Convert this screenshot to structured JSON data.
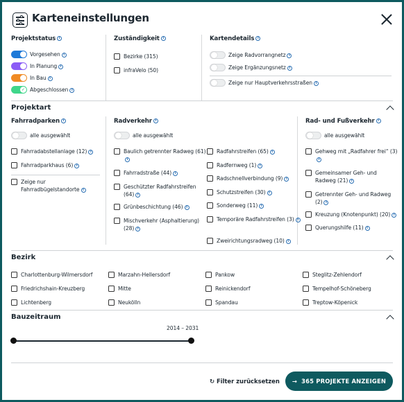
{
  "title": "Karteneinstellungen",
  "projektstatus": {
    "heading": "Projektstatus",
    "items": [
      {
        "label": "Vorgesehen",
        "color": "#1f7ad8"
      },
      {
        "label": "In Planung",
        "color": "#8b5cf6"
      },
      {
        "label": "In Bau",
        "color": "#f08a24"
      },
      {
        "label": "Abgeschlossen",
        "color": "#3fd68a"
      }
    ]
  },
  "zustaendigkeit": {
    "heading": "Zuständigkeit",
    "items": [
      "Bezirke (315)",
      "infraVelo (50)"
    ]
  },
  "kartendetails": {
    "heading": "Kartendetails",
    "items": [
      "Zeige Radvorrangnetz",
      "Zeige Ergänzungsnetz",
      "Zeige nur Hauptverkehrsstraßen"
    ]
  },
  "projektart": {
    "heading": "Projektart",
    "fahrradparken": {
      "heading": "Fahrradparken",
      "all": "alle ausgewählt",
      "items": [
        "Fahrradabstellanlage (12)",
        "Fahrradparkhaus (6)"
      ],
      "extra": [
        "Zeige nur",
        "Fahrradbügelstandorte"
      ]
    },
    "radverkehr": {
      "heading": "Radverkehr",
      "all": "alle ausgewählt",
      "col1": [
        [
          "Baulich getrennter Radweg (61)"
        ],
        [
          "Fahrradstraße (44)"
        ],
        [
          "Geschützter Radfahrstreifen",
          "(64)"
        ],
        [
          "Grünbeschichtung (46)"
        ],
        [
          "Mischverkehr (Asphaltierung)",
          "(28)"
        ]
      ],
      "col2": [
        [
          "Radfahrstreifen (65)"
        ],
        [
          "Radfernweg (1)"
        ],
        [
          "Radschnellverbindung (9)"
        ],
        [
          "Schutzstreifen (30)"
        ],
        [
          "Sonderweg (11)"
        ],
        [
          "Temporäre Radfahrstreifen (3)"
        ],
        [
          "Zweirichtungsradweg (10)"
        ]
      ]
    },
    "fuss": {
      "heading": "Rad- und Fußverkehr",
      "all": "alle ausgewählt",
      "items": [
        [
          "Gehweg mit „Radfahrer frei“ (3)"
        ],
        [
          "Gemeinsamer Geh- und",
          "Radweg (21)"
        ],
        [
          "Getrennter Geh- und Radweg",
          "(2)"
        ],
        [
          "Kreuzung (Knotenpunkt) (20)"
        ],
        [
          "Querungshilfe (11)"
        ]
      ]
    }
  },
  "bezirk": {
    "heading": "Bezirk",
    "items": [
      "Charlottenburg-Wilmersdorf",
      "Marzahn-Hellersdorf",
      "Pankow",
      "Steglitz-Zehlendorf",
      "Friedrichshain-Kreuzberg",
      "Mitte",
      "Reinickendorf",
      "Tempelhof-Schöneberg",
      "Lichtenberg",
      "Neukölln",
      "Spandau",
      "Treptow-Köpenick"
    ]
  },
  "bauzeitraum": {
    "heading": "Bauzeitraum",
    "range": "2014 – 2031",
    "min": 2014,
    "max": 2031
  },
  "footer": {
    "reset": "Filter zurücksetzen",
    "show": "365 PROJEKTE ANZEIGEN"
  }
}
